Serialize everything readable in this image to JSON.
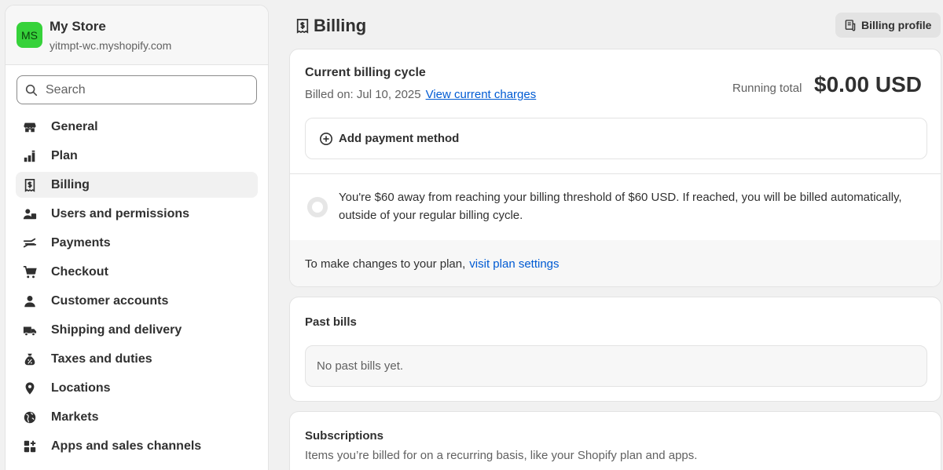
{
  "store": {
    "avatar_initials": "MS",
    "avatar_color": "#36d23a",
    "name": "My Store",
    "domain": "yitmpt-wc.myshopify.com"
  },
  "search": {
    "placeholder": "Search"
  },
  "sidebar": {
    "items": [
      {
        "label": "General",
        "icon": "store-icon",
        "active": false
      },
      {
        "label": "Plan",
        "icon": "plan-icon",
        "active": false
      },
      {
        "label": "Billing",
        "icon": "receipt-icon",
        "active": true
      },
      {
        "label": "Users and permissions",
        "icon": "users-icon",
        "active": false
      },
      {
        "label": "Payments",
        "icon": "payments-icon",
        "active": false
      },
      {
        "label": "Checkout",
        "icon": "cart-icon",
        "active": false
      },
      {
        "label": "Customer accounts",
        "icon": "person-icon",
        "active": false
      },
      {
        "label": "Shipping and delivery",
        "icon": "truck-icon",
        "active": false
      },
      {
        "label": "Taxes and duties",
        "icon": "tax-icon",
        "active": false
      },
      {
        "label": "Locations",
        "icon": "location-pin-icon",
        "active": false
      },
      {
        "label": "Markets",
        "icon": "globe-icon",
        "active": false
      },
      {
        "label": "Apps and sales channels",
        "icon": "apps-icon",
        "active": false
      }
    ]
  },
  "header": {
    "title": "Billing",
    "billing_profile_label": "Billing profile"
  },
  "billing_cycle": {
    "title": "Current billing cycle",
    "billed_on": "Billed on: Jul 10, 2025",
    "view_charges_link": "View current charges",
    "running_total_label": "Running total",
    "running_total_value": "$0.00 USD",
    "add_payment_label": "Add payment method",
    "threshold_message": "You're $60 away from reaching your billing threshold of $60 USD. If reached, you will be billed automatically, outside of your regular billing cycle.",
    "plan_footer_text": "To make changes to your plan,",
    "plan_footer_link": "visit plan settings"
  },
  "past_bills": {
    "title": "Past bills",
    "empty_message": "No past bills yet."
  },
  "subscriptions": {
    "title": "Subscriptions",
    "description": "Items you’re billed for on a recurring basis, like your Shopify plan and apps."
  },
  "colors": {
    "link": "#005bd3",
    "background": "#f1f1f1",
    "card": "#ffffff",
    "text": "#303030",
    "muted_text": "#616161"
  }
}
